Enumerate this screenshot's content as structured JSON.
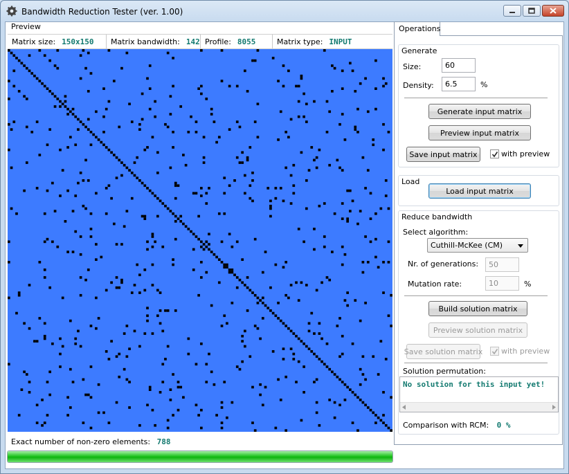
{
  "window": {
    "title": "Bandwidth Reduction Tester (ver. 1.00)"
  },
  "preview": {
    "label": "Preview",
    "stats": [
      {
        "label": "Matrix size:",
        "value": "150x150"
      },
      {
        "label": "Matrix bandwidth:",
        "value": "142"
      },
      {
        "label": "Profile:",
        "value": "8055"
      },
      {
        "label": "Matrix type:",
        "value": "INPUT"
      }
    ],
    "matrix_colors": {
      "background": "#3d7bff",
      "nonzero": "#000000"
    },
    "nonzero_label": "Exact number of non-zero elements:",
    "nonzero_value": "788",
    "progress_fraction": 1.0
  },
  "operations": {
    "tab_label": "Operations",
    "generate": {
      "title": "Generate",
      "size_label": "Size:",
      "size_value": "60",
      "density_label": "Density:",
      "density_value": "6.5",
      "density_unit": "%",
      "generate_button": "Generate input matrix",
      "preview_button": "Preview input matrix",
      "save_button": "Save input matrix",
      "with_preview_label": "with preview",
      "with_preview_checked": true
    },
    "load": {
      "title": "Load",
      "load_button": "Load input matrix"
    },
    "reduce": {
      "title": "Reduce bandwidth",
      "algorithm_label": "Select algorithm:",
      "algorithm_value": "Cuthill-McKee (CM)",
      "generations_label": "Nr. of generations:",
      "generations_value": "50",
      "mutation_label": "Mutation rate:",
      "mutation_value": "10",
      "mutation_unit": "%",
      "build_button": "Build solution matrix",
      "preview_solution_button": "Preview solution matrix",
      "save_solution_button": "Save solution matrix",
      "with_preview_label": "with preview",
      "with_preview_checked": true,
      "permutation_label": "Solution permutation:",
      "permutation_text": "No solution for this input yet!",
      "comparison_label": "Comparison with RCM:",
      "comparison_value": "0 %"
    }
  }
}
